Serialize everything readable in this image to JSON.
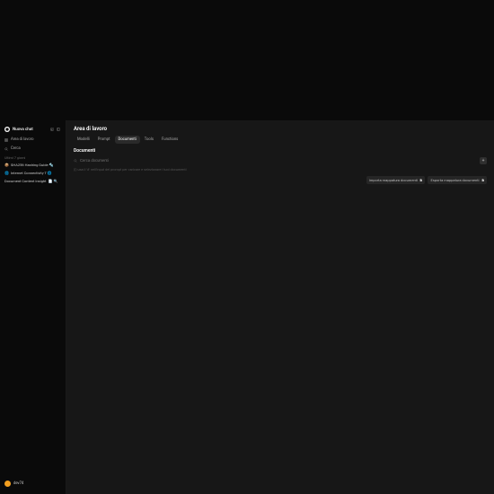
{
  "sidebar": {
    "new_chat": "Nuova chat",
    "workspace": "Area di lavoro",
    "search": "Cerca",
    "section_label": "Ultimi 7 giorni",
    "chats": [
      {
        "emoji": "📦",
        "title": "SHA256 Hashing Guide 🔩"
      },
      {
        "emoji": "🌐",
        "title": "Internet Connectivity T 🌐"
      }
    ],
    "dci_label": "Document Content Insight",
    "dci_emoji": "📄 🔍",
    "user": "dev74"
  },
  "main": {
    "title": "Area di lavoro",
    "tabs": [
      "Modelli",
      "Prompt",
      "Documenti",
      "Tools",
      "Functions"
    ],
    "active_tab": 2,
    "heading": "Documenti",
    "search_placeholder": "Cerca documenti",
    "hint": "(i) usa il '#' nell'input del prompt per caricare e selezionare i tuoi documenti",
    "actions": {
      "import": "Importa mappatura documenti",
      "export": "Esporta mappatura documenti"
    }
  }
}
